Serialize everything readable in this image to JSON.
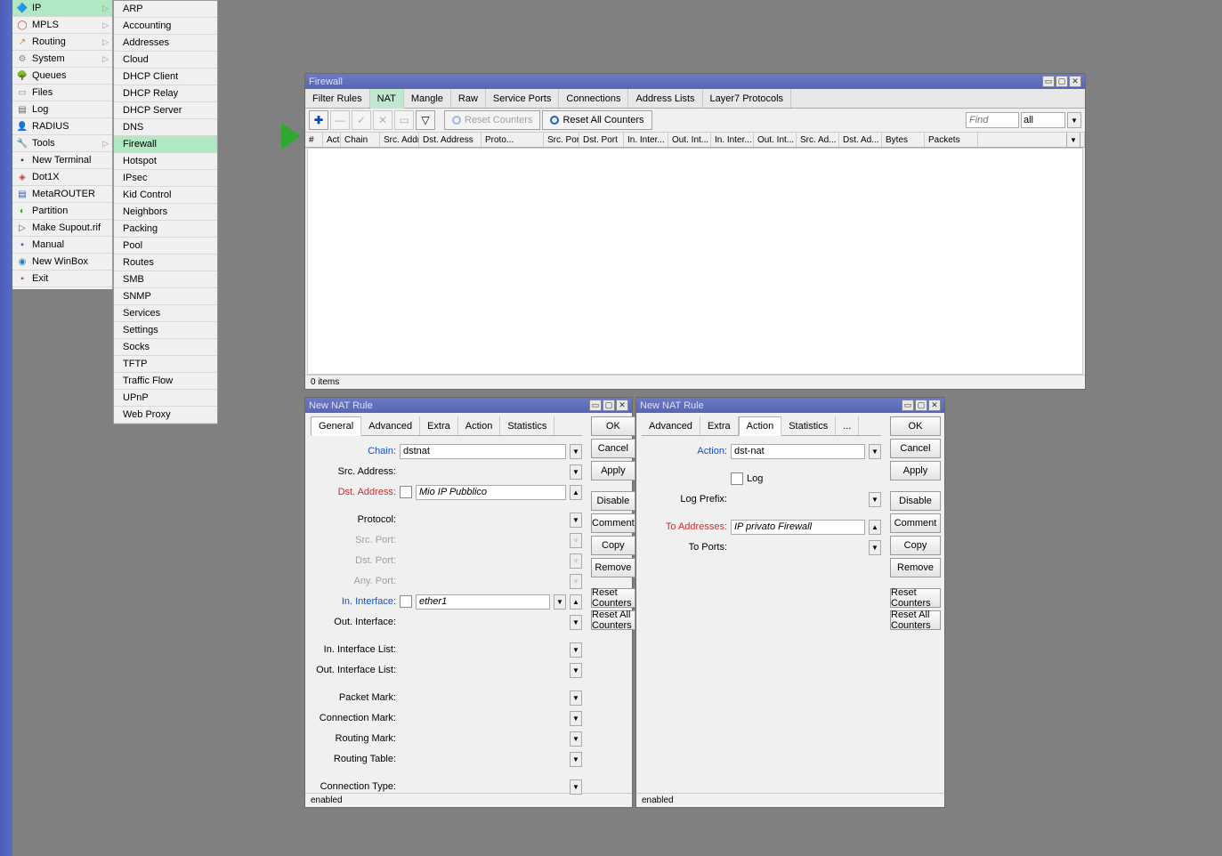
{
  "sidebar": {
    "items": [
      {
        "label": "IP",
        "icon": "🔷",
        "selected": true,
        "arrow": true,
        "color": "#2a7cb8"
      },
      {
        "label": "MPLS",
        "icon": "◯",
        "arrow": true,
        "color": "#b84848"
      },
      {
        "label": "Routing",
        "icon": "↗",
        "arrow": true,
        "color": "#d08020"
      },
      {
        "label": "System",
        "icon": "⚙",
        "arrow": true,
        "color": "#888"
      },
      {
        "label": "Queues",
        "icon": "🌳",
        "color": "#2a7c2a"
      },
      {
        "label": "Files",
        "icon": "▭",
        "color": "#888"
      },
      {
        "label": "Log",
        "icon": "▤",
        "color": "#666"
      },
      {
        "label": "RADIUS",
        "icon": "👤",
        "color": "#c08030"
      },
      {
        "label": "Tools",
        "icon": "🔧",
        "arrow": true,
        "color": "#5a5a5a"
      },
      {
        "label": "New Terminal",
        "icon": "▪",
        "color": "#333"
      },
      {
        "label": "Dot1X",
        "icon": "◈",
        "color": "#b84848"
      },
      {
        "label": "MetaROUTER",
        "icon": "▤",
        "color": "#2a5cb8"
      },
      {
        "label": "Partition",
        "icon": "◐",
        "color": "#30a030"
      },
      {
        "label": "Make Supout.rif",
        "icon": "▷",
        "color": "#2a5cb8"
      },
      {
        "label": "Manual",
        "icon": "▪",
        "color": "#2a5cb8"
      },
      {
        "label": "New WinBox",
        "icon": "◉",
        "color": "#2a7cb8"
      },
      {
        "label": "Exit",
        "icon": "▪",
        "color": "#b84848"
      }
    ]
  },
  "submenu": {
    "items": [
      "ARP",
      "Accounting",
      "Addresses",
      "Cloud",
      "DHCP Client",
      "DHCP Relay",
      "DHCP Server",
      "DNS",
      "Firewall",
      "Hotspot",
      "IPsec",
      "Kid Control",
      "Neighbors",
      "Packing",
      "Pool",
      "Routes",
      "SMB",
      "SNMP",
      "Services",
      "Settings",
      "Socks",
      "TFTP",
      "Traffic Flow",
      "UPnP",
      "Web Proxy"
    ],
    "selected": "Firewall"
  },
  "firewall": {
    "title": "Firewall",
    "tabs": [
      "Filter Rules",
      "NAT",
      "Mangle",
      "Raw",
      "Service Ports",
      "Connections",
      "Address Lists",
      "Layer7 Protocols"
    ],
    "activeTab": "NAT",
    "reset_counters": "Reset Counters",
    "reset_all_counters": "Reset All Counters",
    "find_placeholder": "Find",
    "filter_all": "all",
    "columns": [
      "#",
      "Action",
      "Chain",
      "Src. Address",
      "Dst. Address",
      "Proto...",
      "Src. Port",
      "Dst. Port",
      "In. Inter...",
      "Out. Int...",
      "In. Inter...",
      "Out. Int...",
      "Src. Ad...",
      "Dst. Ad...",
      "Bytes",
      "Packets"
    ],
    "status": "0 items"
  },
  "nat1": {
    "title": "New NAT Rule",
    "tabs": [
      "General",
      "Advanced",
      "Extra",
      "Action",
      "Statistics"
    ],
    "activeTab": "General",
    "fields": {
      "chain_label": "Chain:",
      "chain_value": "dstnat",
      "src_addr_label": "Src. Address:",
      "dst_addr_label": "Dst. Address:",
      "dst_addr_value": "Mio IP Pubblico",
      "protocol_label": "Protocol:",
      "src_port_label": "Src. Port:",
      "dst_port_label": "Dst. Port:",
      "any_port_label": "Any. Port:",
      "in_iface_label": "In. Interface:",
      "in_iface_value": "ether1",
      "out_iface_label": "Out. Interface:",
      "in_iface_list_label": "In. Interface List:",
      "out_iface_list_label": "Out. Interface List:",
      "packet_mark_label": "Packet Mark:",
      "conn_mark_label": "Connection Mark:",
      "routing_mark_label": "Routing Mark:",
      "routing_table_label": "Routing Table:",
      "conn_type_label": "Connection Type:"
    },
    "buttons": [
      "OK",
      "Cancel",
      "Apply",
      "Disable",
      "Comment",
      "Copy",
      "Remove",
      "Reset Counters",
      "Reset All Counters"
    ],
    "status": "enabled"
  },
  "nat2": {
    "title": "New NAT Rule",
    "tabs": [
      "Advanced",
      "Extra",
      "Action",
      "Statistics",
      "..."
    ],
    "activeTab": "Action",
    "fields": {
      "action_label": "Action:",
      "action_value": "dst-nat",
      "log_label": "Log",
      "log_prefix_label": "Log Prefix:",
      "to_addr_label": "To Addresses:",
      "to_addr_value": "IP privato Firewall",
      "to_ports_label": "To Ports:"
    },
    "buttons": [
      "OK",
      "Cancel",
      "Apply",
      "Disable",
      "Comment",
      "Copy",
      "Remove",
      "Reset Counters",
      "Reset All Counters"
    ],
    "status": "enabled"
  }
}
